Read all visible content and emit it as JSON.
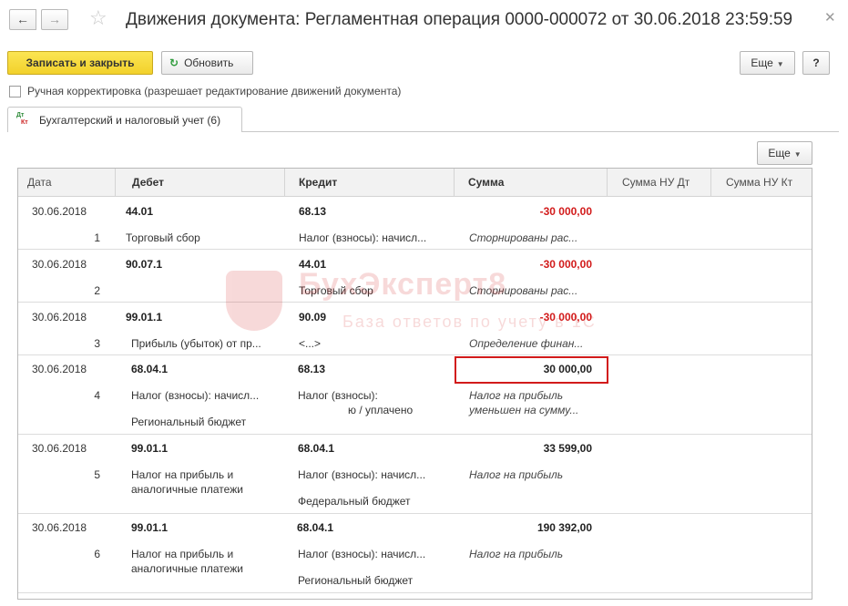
{
  "window": {
    "title": "Движения документа: Регламентная операция 0000-000072 от 30.06.2018 23:59:59",
    "back_glyph": "←",
    "forward_glyph": "→",
    "favorite_glyph": "☆",
    "close_glyph": "✕"
  },
  "toolbar": {
    "save_close_label": "Записать и закрыть",
    "refresh_label": "Обновить",
    "refresh_glyph": "↻",
    "more_label": "Еще",
    "help_label": "?"
  },
  "manual_edit": {
    "label": "Ручная корректировка (разрешает редактирование движений документа)",
    "checked": false
  },
  "tab": {
    "label": "Бухгалтерский и налоговый учет (6)",
    "icon_dt": "Дт",
    "icon_kt": "Кт"
  },
  "panel": {
    "more_label": "Еще"
  },
  "table": {
    "columns": [
      "Дата",
      "Дебет",
      "Кредит",
      "Сумма",
      "Сумма НУ Дт",
      "Сумма НУ Кт"
    ],
    "rows": [
      {
        "date": "30.06.2018",
        "num": "1",
        "debit_account": "44.01",
        "debit_sub": [
          "Торговый сбор"
        ],
        "credit_account": "68.13",
        "credit_sub": [
          "Налог (взносы): начисл..."
        ],
        "amount": "-30 000,00",
        "content": [
          "Сторнированы рас..."
        ],
        "negative": true,
        "highlighted": false
      },
      {
        "date": "30.06.2018",
        "num": "2",
        "debit_account": "90.07.1",
        "debit_sub": [],
        "credit_account": "44.01",
        "credit_sub": [
          "Торговый сбор"
        ],
        "amount": "-30 000,00",
        "content": [
          "Сторнированы рас..."
        ],
        "negative": true,
        "highlighted": false
      },
      {
        "date": "30.06.2018",
        "num": "3",
        "debit_account": "99.01.1",
        "debit_sub": [
          "Прибыль (убыток) от пр..."
        ],
        "credit_account": "90.09",
        "credit_sub": [
          "<...>"
        ],
        "amount": "-30 000,00",
        "content": [
          "Определение финан..."
        ],
        "negative": true,
        "highlighted": false
      },
      {
        "date": "30.06.2018",
        "num": "4",
        "debit_account": "68.04.1",
        "debit_sub": [
          "Налог (взносы): начисл...",
          "Региональный бюджет"
        ],
        "credit_account": "68.13",
        "credit_sub": [
          "Налог (взносы):",
          "ю / уплачено"
        ],
        "amount": "30 000,00",
        "content": [
          "Налог на прибыль",
          "уменьшен на сумму..."
        ],
        "negative": false,
        "highlighted": true
      },
      {
        "date": "30.06.2018",
        "num": "5",
        "debit_account": "99.01.1",
        "debit_sub": [
          "Налог на прибыль и",
          "аналогичные платежи"
        ],
        "credit_account": "68.04.1",
        "credit_sub": [
          "Налог (взносы): начисл...",
          "Федеральный бюджет"
        ],
        "amount": "33 599,00",
        "content": [
          "Налог на прибыль"
        ],
        "negative": false,
        "highlighted": false
      },
      {
        "date": "30.06.2018",
        "num": "6",
        "debit_account": "99.01.1",
        "debit_sub": [
          "Налог на прибыль и",
          "аналогичные платежи"
        ],
        "credit_account": "68.04.1",
        "credit_sub": [
          "Налог (взносы): начисл...",
          "Региональный бюджет"
        ],
        "amount": "190 392,00",
        "content": [
          "Налог на прибыль"
        ],
        "negative": false,
        "highlighted": false
      }
    ]
  },
  "watermark": {
    "title": "БухЭксперт8",
    "subtitle": "База ответов по учету в 1С"
  },
  "colors": {
    "accent_yellow": "#f2d12b",
    "negative_red": "#d21b1b",
    "highlight_border": "#d21b1b"
  }
}
